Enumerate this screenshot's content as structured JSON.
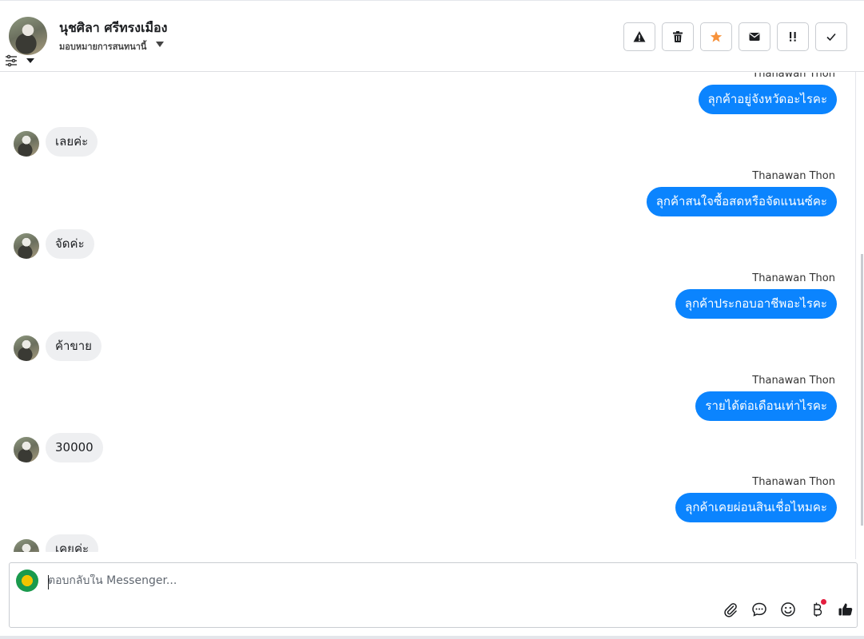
{
  "header": {
    "name": "นุชศิลา ศรีทรงเมือง",
    "assign_label": "มอบหมายการสนทนานี้",
    "actions": [
      {
        "name": "report-button",
        "icon": "warning-icon"
      },
      {
        "name": "delete-button",
        "icon": "trash-icon"
      },
      {
        "name": "star-button",
        "icon": "star-icon",
        "color": "#f7923b"
      },
      {
        "name": "mark-unread-button",
        "icon": "envelope-icon"
      },
      {
        "name": "spam-button",
        "icon": "exclamation-icon"
      },
      {
        "name": "done-button",
        "icon": "check-icon"
      }
    ]
  },
  "messages": [
    {
      "dir": "out",
      "sender": "Thanawan Thon",
      "text": "ลุกค้าอยู่จังหวัดอะไรคะ"
    },
    {
      "dir": "in",
      "text": "เลยค่ะ"
    },
    {
      "dir": "out",
      "sender": "Thanawan Thon",
      "text": "ลุกค้าสนใจซื้อสดหรือจัดแนนซ์คะ"
    },
    {
      "dir": "in",
      "text": "จัดค่ะ"
    },
    {
      "dir": "out",
      "sender": "Thanawan Thon",
      "text": "ลุกค้าประกอบอาชีพอะไรคะ"
    },
    {
      "dir": "in",
      "text": "ค้าขาย"
    },
    {
      "dir": "out",
      "sender": "Thanawan Thon",
      "text": "รายได้ต่อเดือนเท่าไรคะ"
    },
    {
      "dir": "in",
      "text": "30000"
    },
    {
      "dir": "out",
      "sender": "Thanawan Thon",
      "text": "ลุกค้าเคยผ่อนสินเชื่อไหมคะ"
    },
    {
      "dir": "in",
      "text": "เคยค่ะ"
    }
  ],
  "composer": {
    "placeholder": "ตอบกลับใน Messenger...",
    "tools": [
      "paperclip-icon",
      "chat-bubble-icon",
      "emoji-icon",
      "baht-icon",
      "thumbs-up-icon"
    ]
  },
  "colors": {
    "outgoing_bubble": "#0b84fe",
    "incoming_bubble": "#eeeff1",
    "star_accent": "#f7923b",
    "notification_dot": "#e41e3f"
  }
}
